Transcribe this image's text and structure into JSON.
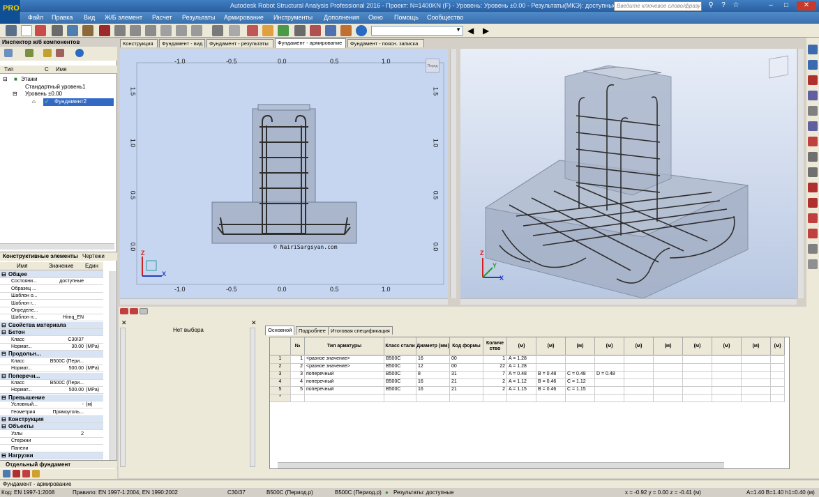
{
  "app": {
    "title": "Autodesk Robot Structural Analysis Professional 2016 - Проект: N=1400KN (F) - Уровень: Уровень ±0.00 - Результаты(МКЭ): доступные - Результаты: доступные",
    "icon_label": "PRO",
    "search_placeholder": "Введите ключевое слово/фразу"
  },
  "menu": [
    "Файл",
    "Правка",
    "Вид",
    "Ж/Б элемент",
    "Расчет",
    "Результаты",
    "Армирование",
    "Инструменты",
    "Дополнения",
    "Окно",
    "Помощь",
    "Сообщество"
  ],
  "inspector": {
    "title": "Инспектор ж/б компонентов",
    "col_type": "Тип",
    "col_c": "С",
    "col_name": "Имя",
    "tree": [
      "Этажи",
      "Стандартный уровень1",
      "Уровень ±0.00",
      "Фундамент2"
    ],
    "tabs": [
      "Конструктивные элементы",
      "Чертежи"
    ],
    "headers": [
      "Имя",
      "Значение",
      "Един"
    ],
    "rows": [
      {
        "g": true,
        "name": "Общее"
      },
      {
        "name": "Состояни...",
        "value": "доступные",
        "unit": ""
      },
      {
        "name": "Образец ...",
        "value": "",
        "unit": ""
      },
      {
        "name": "Шаблон о...",
        "value": "",
        "unit": ""
      },
      {
        "name": "Шаблон г...",
        "value": "",
        "unit": ""
      },
      {
        "name": "Определе...",
        "value": "",
        "unit": ""
      },
      {
        "name": "Шаблон н...",
        "value": "Himq_EN",
        "unit": ""
      },
      {
        "g": true,
        "name": "Свойства материала"
      },
      {
        "g": true,
        "name": "Бетон"
      },
      {
        "name": "Класс",
        "value": "C30/37",
        "unit": ""
      },
      {
        "name": "Нормат...",
        "value": "30.00",
        "unit": "(MPa)"
      },
      {
        "g": true,
        "name": "Продольн..."
      },
      {
        "name": "Класс",
        "value": "B500C (Пери...",
        "unit": ""
      },
      {
        "name": "Нормат...",
        "value": "500.00",
        "unit": "(MPa)"
      },
      {
        "g": true,
        "name": "Поперечн..."
      },
      {
        "name": "Класс",
        "value": "B500C (Пери...",
        "unit": ""
      },
      {
        "name": "Нормат...",
        "value": "500.00",
        "unit": "(MPa)"
      },
      {
        "g": true,
        "name": "Превышение"
      },
      {
        "name": "Условный...",
        "value": "-",
        "unit": "(м)"
      },
      {
        "name": "Геометрия",
        "value": "Прямоуголь...",
        "unit": ""
      },
      {
        "g": true,
        "name": "Конструкция"
      },
      {
        "g": true,
        "name": "Объекты"
      },
      {
        "name": "Узлы",
        "value": "2",
        "unit": ""
      },
      {
        "name": "Стержни",
        "value": "",
        "unit": ""
      },
      {
        "name": "Панели",
        "value": "",
        "unit": ""
      },
      {
        "g": true,
        "name": "Нагрузки"
      }
    ],
    "bottom_tab": "Отдельный фундамент"
  },
  "doc_tabs": [
    "Конструкция",
    "Фундамент - вид",
    "Фундамент - результаты",
    "Фундамент - армирование",
    "Фундамент - поясн. записка"
  ],
  "view2d": {
    "x_ticks": [
      "-1.0",
      "-0.5",
      "0.0",
      "0.5",
      "1.0"
    ],
    "y_ticks": [
      "1.5",
      "1.0",
      "0.5",
      "0.0"
    ],
    "axis_x": "X",
    "axis_z": "Z",
    "watermark": "© NairiSargsyan.com",
    "cube_label": "Перед"
  },
  "view3d": {
    "axis_x": "X",
    "axis_y": "Y",
    "axis_z": "Z"
  },
  "panel": {
    "no_selection": "Нет выбора",
    "tabs": [
      "Основной",
      "Подробнее",
      "Итоговая спецификация"
    ],
    "columns": [
      "№",
      "Тип арматуры",
      "Класс стали",
      "Диаметр (мм)",
      "Код формы",
      "Количе ство",
      "(м)",
      "(м)",
      "(м)",
      "(м)",
      "(м)",
      "(м)",
      "(м)",
      "(м)",
      "(м)",
      "(м)"
    ],
    "rows": [
      [
        "1",
        "<разное значение>",
        "B500C",
        "16",
        "00",
        "1",
        "A = 1.28",
        "",
        "",
        ""
      ],
      [
        "2",
        "<разное значение>",
        "B500C",
        "12",
        "00",
        "22",
        "A = 1.28",
        "",
        "",
        ""
      ],
      [
        "3",
        "поперечный",
        "B500C",
        "8",
        "31",
        "7",
        "A = 0.48",
        "B = 0.48",
        "C = 0.48",
        "D = 0.48"
      ],
      [
        "4",
        "поперечный",
        "B500C",
        "16",
        "21",
        "2",
        "A = 1.12",
        "B = 0.46",
        "C = 1.12",
        ""
      ],
      [
        "5",
        "поперечный",
        "B500C",
        "16",
        "21",
        "2",
        "A = 1.15",
        "B = 0.46",
        "C = 1.15",
        ""
      ]
    ],
    "new_row": "*"
  },
  "status": {
    "window": "Фундамент - армирование",
    "code": "Код: EN 1997-1:2008",
    "rule": "Правило: EN 1997-1:2004, EN 1990:2002",
    "concrete": "C30/37",
    "long_rebar": "B500C (Период.р)",
    "trans_rebar": "B500C (Период.р)",
    "results": "Результаты: доступные",
    "coords": "x = -0.92  y = 0.00  z = -0.41  (м)",
    "dims": "A=1.40 B=1.40 h1=0.40 (м)"
  },
  "colors": {
    "title": "#2b5fa0",
    "menu": "#3a70ad",
    "selection": "#316ac5",
    "view2d_bg": "#c6d6f1",
    "rebar": "#2e2e2e"
  }
}
